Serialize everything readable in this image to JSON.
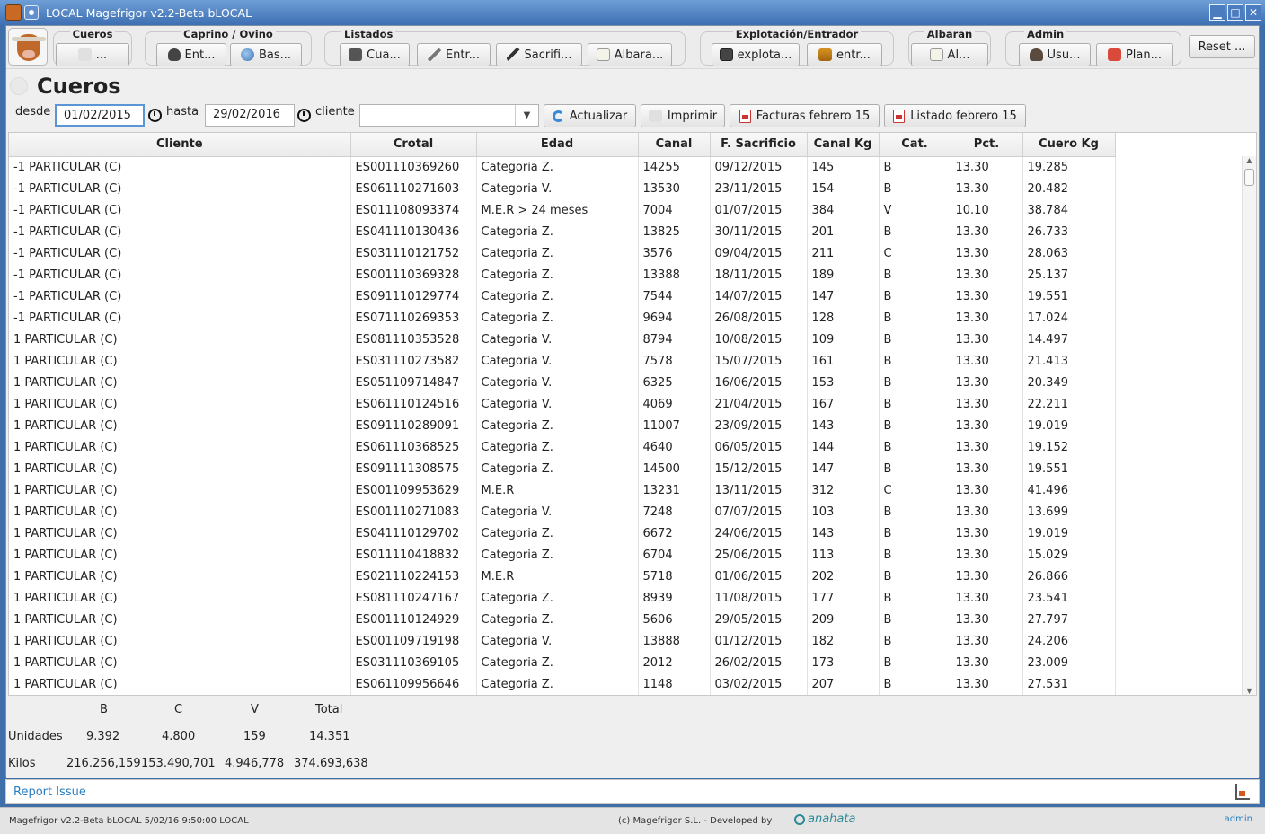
{
  "window": {
    "title": "LOCAL Magefrigor v2.2-Beta bLOCAL",
    "minimize": "▁",
    "maximize": "□",
    "close": "✕"
  },
  "toolbar": {
    "groups": [
      {
        "title": "Cueros",
        "buttons": [
          {
            "label": "...",
            "icon": "hidden-icon"
          }
        ]
      },
      {
        "title": "Caprino / Ovino",
        "buttons": [
          {
            "label": "Ent...",
            "icon": "ear-icon"
          },
          {
            "label": "Bas...",
            "icon": "globe-icon"
          }
        ]
      },
      {
        "title": "Listados",
        "buttons": [
          {
            "label": "Cua...",
            "icon": "clapboard-icon"
          },
          {
            "label": "Entr...",
            "icon": "knife-icon"
          },
          {
            "label": "Sacrifi...",
            "icon": "pen-icon"
          },
          {
            "label": "Albara...",
            "icon": "document-icon"
          }
        ]
      },
      {
        "title": "Explotación/Entrador",
        "buttons": [
          {
            "label": "explota...",
            "icon": "picture-icon"
          },
          {
            "label": "entr...",
            "icon": "truck-icon"
          }
        ]
      },
      {
        "title": "Albaran",
        "buttons": [
          {
            "label": "Al...",
            "icon": "document-icon"
          }
        ]
      },
      {
        "title": "Admin",
        "buttons": [
          {
            "label": "Usu...",
            "icon": "user-icon"
          },
          {
            "label": "Plan...",
            "icon": "plan-icon"
          }
        ]
      }
    ],
    "reset_label": "Reset ..."
  },
  "page": {
    "title": "Cueros"
  },
  "filters": {
    "desde_label": "desde",
    "desde_value": "01/02/2015",
    "hasta_label": "hasta",
    "hasta_value": "29/02/2016",
    "cliente_label": "cliente",
    "cliente_value": "",
    "actualizar_label": "Actualizar",
    "imprimir_label": "Imprimir",
    "facturas_label": "Facturas febrero 15",
    "listado_label": "Listado febrero 15"
  },
  "table": {
    "columns": [
      "Cliente",
      "Crotal",
      "Edad",
      "Canal",
      "F. Sacrificio",
      "Canal Kg",
      "Cat.",
      "Pct.",
      "Cuero Kg"
    ],
    "rows": [
      [
        "-1 PARTICULAR (C)",
        "ES001110369260",
        "Categoria Z.",
        "14255",
        "09/12/2015",
        "145",
        "B",
        "13.30",
        "19.285"
      ],
      [
        "-1 PARTICULAR (C)",
        "ES061110271603",
        "Categoria V.",
        "13530",
        "23/11/2015",
        "154",
        "B",
        "13.30",
        "20.482"
      ],
      [
        "-1 PARTICULAR (C)",
        "ES011108093374",
        "M.E.R > 24 meses",
        "7004",
        "01/07/2015",
        "384",
        "V",
        "10.10",
        "38.784"
      ],
      [
        "-1 PARTICULAR (C)",
        "ES041110130436",
        "Categoria Z.",
        "13825",
        "30/11/2015",
        "201",
        "B",
        "13.30",
        "26.733"
      ],
      [
        "-1 PARTICULAR (C)",
        "ES031110121752",
        "Categoria Z.",
        "3576",
        "09/04/2015",
        "211",
        "C",
        "13.30",
        "28.063"
      ],
      [
        "-1 PARTICULAR (C)",
        "ES001110369328",
        "Categoria Z.",
        "13388",
        "18/11/2015",
        "189",
        "B",
        "13.30",
        "25.137"
      ],
      [
        "-1 PARTICULAR (C)",
        "ES091110129774",
        "Categoria Z.",
        "7544",
        "14/07/2015",
        "147",
        "B",
        "13.30",
        "19.551"
      ],
      [
        "-1 PARTICULAR (C)",
        "ES071110269353",
        "Categoria Z.",
        "9694",
        "26/08/2015",
        "128",
        "B",
        "13.30",
        "17.024"
      ],
      [
        "1 PARTICULAR (C)",
        "ES081110353528",
        "Categoria V.",
        "8794",
        "10/08/2015",
        "109",
        "B",
        "13.30",
        "14.497"
      ],
      [
        "1 PARTICULAR (C)",
        "ES031110273582",
        "Categoria V.",
        "7578",
        "15/07/2015",
        "161",
        "B",
        "13.30",
        "21.413"
      ],
      [
        "1 PARTICULAR (C)",
        "ES051109714847",
        "Categoria V.",
        "6325",
        "16/06/2015",
        "153",
        "B",
        "13.30",
        "20.349"
      ],
      [
        "1 PARTICULAR (C)",
        "ES061110124516",
        "Categoria V.",
        "4069",
        "21/04/2015",
        "167",
        "B",
        "13.30",
        "22.211"
      ],
      [
        "1 PARTICULAR (C)",
        "ES091110289091",
        "Categoria Z.",
        "11007",
        "23/09/2015",
        "143",
        "B",
        "13.30",
        "19.019"
      ],
      [
        "1 PARTICULAR (C)",
        "ES061110368525",
        "Categoria Z.",
        "4640",
        "06/05/2015",
        "144",
        "B",
        "13.30",
        "19.152"
      ],
      [
        "1 PARTICULAR (C)",
        "ES091111308575",
        "Categoria Z.",
        "14500",
        "15/12/2015",
        "147",
        "B",
        "13.30",
        "19.551"
      ],
      [
        "1 PARTICULAR (C)",
        "ES001109953629",
        "M.E.R",
        "13231",
        "13/11/2015",
        "312",
        "C",
        "13.30",
        "41.496"
      ],
      [
        "1 PARTICULAR (C)",
        "ES001110271083",
        "Categoria V.",
        "7248",
        "07/07/2015",
        "103",
        "B",
        "13.30",
        "13.699"
      ],
      [
        "1 PARTICULAR (C)",
        "ES041110129702",
        "Categoria Z.",
        "6672",
        "24/06/2015",
        "143",
        "B",
        "13.30",
        "19.019"
      ],
      [
        "1 PARTICULAR (C)",
        "ES011110418832",
        "Categoria Z.",
        "6704",
        "25/06/2015",
        "113",
        "B",
        "13.30",
        "15.029"
      ],
      [
        "1 PARTICULAR (C)",
        "ES021110224153",
        "M.E.R",
        "5718",
        "01/06/2015",
        "202",
        "B",
        "13.30",
        "26.866"
      ],
      [
        "1 PARTICULAR (C)",
        "ES081110247167",
        "Categoria Z.",
        "8939",
        "11/08/2015",
        "177",
        "B",
        "13.30",
        "23.541"
      ],
      [
        "1 PARTICULAR (C)",
        "ES001110124929",
        "Categoria Z.",
        "5606",
        "29/05/2015",
        "209",
        "B",
        "13.30",
        "27.797"
      ],
      [
        "1 PARTICULAR (C)",
        "ES001109719198",
        "Categoria V.",
        "13888",
        "01/12/2015",
        "182",
        "B",
        "13.30",
        "24.206"
      ],
      [
        "1 PARTICULAR (C)",
        "ES031110369105",
        "Categoria Z.",
        "2012",
        "26/02/2015",
        "173",
        "B",
        "13.30",
        "23.009"
      ],
      [
        "1 PARTICULAR (C)",
        "ES061109956646",
        "Categoria Z.",
        "1148",
        "03/02/2015",
        "207",
        "B",
        "13.30",
        "27.531"
      ]
    ]
  },
  "summary": {
    "headers": [
      "B",
      "C",
      "V",
      "Total"
    ],
    "unidades_label": "Unidades",
    "unidades": [
      "9.392",
      "4.800",
      "159",
      "14.351"
    ],
    "kilos_label": "Kilos",
    "kilos": [
      "216.256,159",
      "153.490,701",
      "4.946,778",
      "374.693,638"
    ]
  },
  "report": {
    "label": "Report Issue"
  },
  "footer": {
    "left": "Magefrigor v2.2-Beta bLOCAL 5/02/16 9:50:00 LOCAL",
    "copyright": "(c)  Magefrigor S.L.   - Developed by",
    "brand": "anahata",
    "user": "admin"
  }
}
